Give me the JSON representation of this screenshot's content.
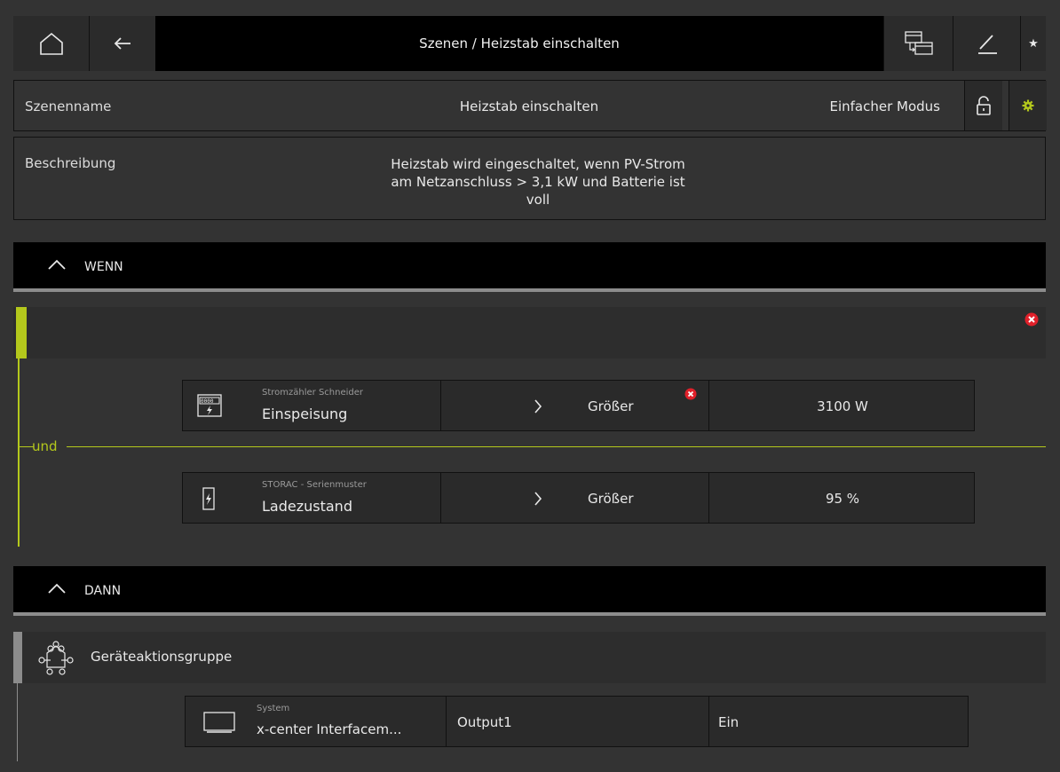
{
  "header": {
    "breadcrumb": "Szenen / Heizstab einschalten",
    "icons": [
      "home-icon",
      "back-arrow-icon",
      "scene-switch-icon",
      "edit-pencil-icon",
      "favorite-star-icon"
    ]
  },
  "scene": {
    "name_label": "Szenenname",
    "name_value": "Heizstab einschalten",
    "mode": "Einfacher Modus",
    "description_label": "Beschreibung",
    "description_lines": [
      "Heizstab wird eingeschaltet, wenn PV-Strom",
      "am Netzanschluss > 3,1 kW und Batterie ist",
      "voll"
    ]
  },
  "wenn": {
    "title": "WENN",
    "connector": "und",
    "conditions": [
      {
        "device": "Stromzähler Schneider",
        "property": "Einspeisung",
        "operator": "Größer",
        "value": "3100 W",
        "error": true
      },
      {
        "device": "STORAC - Serienmuster",
        "property": "Ladezustand",
        "operator": "Größer",
        "value": "95 %",
        "error": false
      }
    ]
  },
  "dann": {
    "title": "DANN",
    "group_title": "Geräteaktionsgruppe",
    "actions": [
      {
        "device": "System",
        "name": "x-center Interfacem...",
        "output": "Output1",
        "value": "Ein"
      }
    ]
  },
  "colors": {
    "accent": "#b4c81c",
    "error": "#e0202a",
    "background": "#333333",
    "header": "#000000"
  }
}
